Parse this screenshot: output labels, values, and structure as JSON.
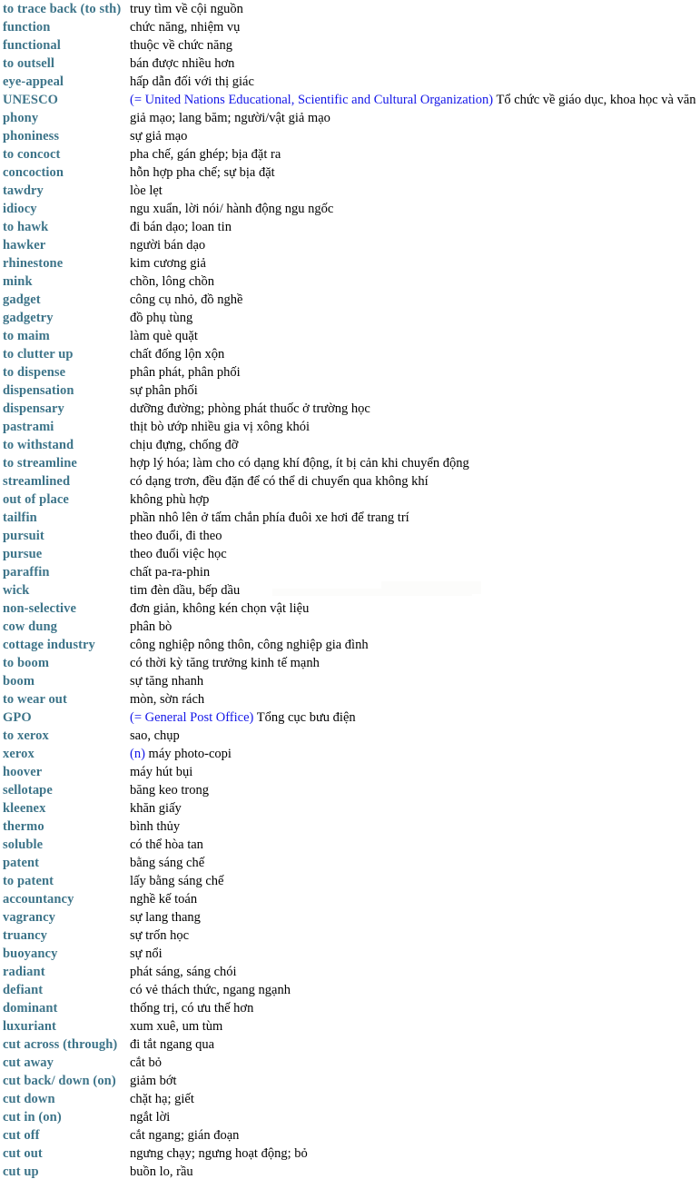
{
  "document": {
    "kind": "bilingual-glossary",
    "source_language": "English",
    "target_language": "Vietnamese",
    "term_color": "#3d7489",
    "definition_color": "#000000",
    "annotation_color": "#1417e8",
    "background_color": "#ffffff"
  },
  "entries": [
    {
      "term": "to trace back (to sth)",
      "definition": "truy tìm về cội nguồn"
    },
    {
      "term": "function",
      "definition": "chức năng, nhiệm vụ"
    },
    {
      "term": "functional",
      "definition": "thuộc về chức năng"
    },
    {
      "term": "to outsell",
      "definition": "bán được nhiều hơn"
    },
    {
      "term": "eye-appeal",
      "definition": "hấp dẫn đối với thị giác"
    },
    {
      "term": "UNESCO",
      "annotation": "(= United Nations Educational, Scientific and Cultural Organization)",
      "definition": " Tổ chức về giáo dục, khoa học và văn"
    },
    {
      "term": "phony",
      "definition": "giả mạo; lang băm; người/vật giả mạo"
    },
    {
      "term": "phoniness",
      "definition": "sự giả mạo"
    },
    {
      "term": "to concoct",
      "definition": "pha chế, gán ghép; bịa đặt ra"
    },
    {
      "term": "concoction",
      "definition": "hỗn hợp pha chế; sự bịa đặt"
    },
    {
      "term": "tawdry",
      "definition": "lòe lẹt"
    },
    {
      "term": "idiocy",
      "definition": "ngu xuẩn, lời nói/ hành động ngu ngốc"
    },
    {
      "term": "to hawk",
      "definition": "đi bán dạo; loan tin"
    },
    {
      "term": "hawker",
      "definition": "người bán dạo"
    },
    {
      "term": "rhinestone",
      "definition": "kim cương giả"
    },
    {
      "term": "mink",
      "definition": "chồn, lông chồn"
    },
    {
      "term": "gadget",
      "definition": "công cụ nhỏ, đồ nghề"
    },
    {
      "term": "gadgetry",
      "definition": "đồ phụ tùng"
    },
    {
      "term": "to maim",
      "definition": "làm què quặt"
    },
    {
      "term": "to clutter up",
      "definition": "chất đống lộn xộn"
    },
    {
      "term": "to dispense",
      "definition": "phân phát, phân phối"
    },
    {
      "term": "dispensation",
      "definition": "sự phân phối"
    },
    {
      "term": "dispensary",
      "definition": "dưỡng đường; phòng phát thuốc ở trường học"
    },
    {
      "term": "pastrami",
      "definition": "thịt bò ướp nhiều gia vị xông khói"
    },
    {
      "term": "to withstand",
      "definition": "chịu đựng, chống đỡ"
    },
    {
      "term": "to streamline",
      "definition": "hợp lý hóa; làm cho có dạng khí động, ít bị cản khi chuyển động"
    },
    {
      "term": "streamlined",
      "definition": "có dạng trơn, đều đặn để có thể di chuyển qua không khí"
    },
    {
      "term": "out of place",
      "definition": "không phù hợp"
    },
    {
      "term": "tailfin",
      "definition": "phần nhô lên ở tấm chắn phía đuôi xe hơi để trang trí"
    },
    {
      "term": "pursuit",
      "definition": "theo đuổi, đi theo"
    },
    {
      "term": "pursue",
      "definition": "theo đuổi việc học"
    },
    {
      "term": "paraffin",
      "definition": "chất pa-ra-phin"
    },
    {
      "term": "wick",
      "definition": "tim đèn dầu, bếp dầu"
    },
    {
      "term": "non-selective",
      "definition": "đơn giản, không kén chọn vật liệu"
    },
    {
      "term": "cow dung",
      "definition": "phân bò"
    },
    {
      "term": "cottage industry",
      "definition": "công nghiệp nông thôn, công nghiệp gia đình"
    },
    {
      "term": "to boom",
      "definition": "có thời kỳ tăng trưởng kinh tế mạnh"
    },
    {
      "term": "boom",
      "definition": "sự tăng nhanh"
    },
    {
      "term": "to wear out",
      "definition": "mòn, sờn rách"
    },
    {
      "term": "GPO",
      "annotation": "(= General Post Office)",
      "definition": " Tổng cục bưu điện"
    },
    {
      "term": "to xerox",
      "definition": "sao, chụp"
    },
    {
      "term": "xerox",
      "annotation": "(n)",
      "definition": " máy photo-copi"
    },
    {
      "term": "hoover",
      "definition": "máy hút bụi"
    },
    {
      "term": "sellotape",
      "definition": "băng keo trong"
    },
    {
      "term": "kleenex",
      "definition": "khăn giấy"
    },
    {
      "term": "thermo",
      "definition": "bình thủy"
    },
    {
      "term": "soluble",
      "definition": "có thể hòa tan"
    },
    {
      "term": "patent",
      "definition": "bằng sáng chế"
    },
    {
      "term": "to patent",
      "definition": "lấy bằng sáng chế"
    },
    {
      "term": "accountancy",
      "definition": "nghề kế toán"
    },
    {
      "term": "vagrancy",
      "definition": "sự lang thang"
    },
    {
      "term": "truancy",
      "definition": "sự trốn học"
    },
    {
      "term": "buoyancy",
      "definition": "sự nổi"
    },
    {
      "term": "radiant",
      "definition": "phát sáng, sáng chói"
    },
    {
      "term": "defiant",
      "definition": "có vẻ thách thức, ngang ngạnh"
    },
    {
      "term": "dominant",
      "definition": "thống trị, có ưu thế hơn"
    },
    {
      "term": "luxuriant",
      "definition": "xum xuê, um tùm"
    },
    {
      "term": "cut across (through)",
      "definition": "đi tắt ngang qua"
    },
    {
      "term": "cut away",
      "definition": "cắt bỏ"
    },
    {
      "term": "cut back/ down (on)",
      "definition": "giảm bớt"
    },
    {
      "term": "cut down",
      "definition": "chặt hạ; giết"
    },
    {
      "term": "cut in (on)",
      "definition": "ngắt lời"
    },
    {
      "term": "cut off",
      "definition": "cắt ngang; gián đoạn"
    },
    {
      "term": "cut out",
      "definition": "ngưng chạy; ngưng hoạt động; bỏ"
    },
    {
      "term": "cut up",
      "definition": "buồn lo, rầu"
    }
  ]
}
